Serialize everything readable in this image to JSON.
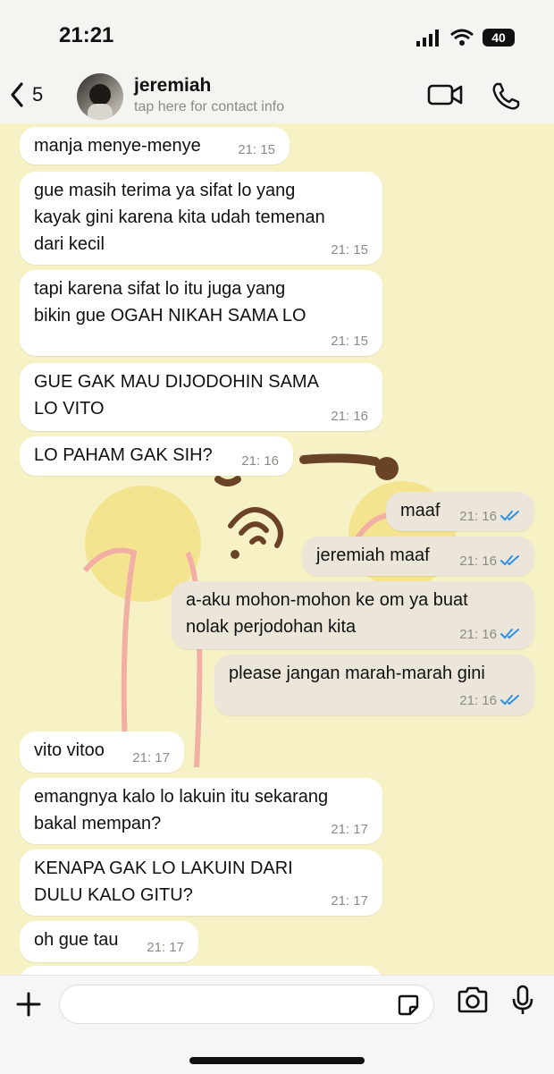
{
  "status": {
    "time": "21:21",
    "battery": "40"
  },
  "header": {
    "back_count": "5",
    "contact_name": "jeremiah",
    "contact_sub": "tap here for contact info"
  },
  "messages": [
    {
      "dir": "in",
      "text": "manja menye-menye",
      "time": "21: 15"
    },
    {
      "dir": "in",
      "text": "gue masih terima ya sifat lo yang\nkayak gini karena kita udah temenan\ndari kecil",
      "time": "21: 15"
    },
    {
      "dir": "in",
      "text": "tapi karena sifat lo itu juga yang\nbikin gue OGAH NIKAH SAMA LO",
      "time": "21: 15"
    },
    {
      "dir": "in",
      "text": "GUE GAK MAU DIJODOHIN SAMA\nLO VITO",
      "time": "21: 16"
    },
    {
      "dir": "in",
      "text": "LO PAHAM GAK SIH?",
      "time": "21: 16"
    },
    {
      "dir": "out",
      "text": "maaf",
      "time": "21: 16"
    },
    {
      "dir": "out",
      "text": "jeremiah maaf",
      "time": "21: 16"
    },
    {
      "dir": "out",
      "text": "a-aku mohon-mohon ke om ya buat\nnolak perjodohan kita",
      "time": "21: 16"
    },
    {
      "dir": "out",
      "text": "please jangan marah-marah gini",
      "time": "21: 16"
    },
    {
      "dir": "in",
      "text": "vito vitoo",
      "time": "21: 17"
    },
    {
      "dir": "in",
      "text": "emangnya kalo lo lakuin itu sekarang\nbakal mempan?",
      "time": "21: 17"
    },
    {
      "dir": "in",
      "text": "KENAPA GAK LO LAKUIN DARI\nDULU KALO GITU?",
      "time": "21: 17"
    },
    {
      "dir": "in",
      "text": "oh gue tau",
      "time": "21: 17"
    }
  ],
  "colors": {
    "chat_bg": "#f6f2c6",
    "incoming": "#ffffff",
    "outgoing": "#ece6da",
    "read_ticks": "#2f8fe8"
  }
}
